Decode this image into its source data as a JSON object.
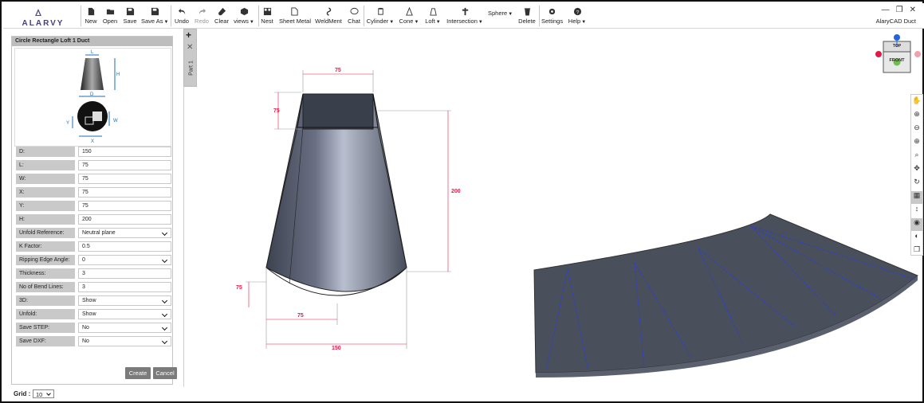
{
  "app": {
    "title": "AlaryCAD Duct",
    "logo_text": "ALARVY"
  },
  "toolbar": {
    "new": "New",
    "open": "Open",
    "save": "Save",
    "save_as": "Save As",
    "undo": "Undo",
    "redo": "Redo",
    "clear": "Clear",
    "views": "views",
    "nest": "Nest",
    "sheet_metal": "Sheet Metal",
    "weldment": "WeldMent",
    "chat": "Chat",
    "cylinder": "Cylinder",
    "cone": "Cone",
    "loft": "Loft",
    "intersection": "Intersection",
    "sphere": "Sphere",
    "delete": "Delete",
    "settings": "Settings",
    "help": "Help"
  },
  "panel": {
    "title": "Circle Rectangle Loft 1 Duct",
    "diagram_labels": {
      "L": "L",
      "H": "H",
      "D": "D",
      "Y": "Y",
      "W": "W",
      "X": "X"
    },
    "fields": [
      {
        "label": "D:",
        "value": "150",
        "type": "text"
      },
      {
        "label": "L:",
        "value": "75",
        "type": "text"
      },
      {
        "label": "W:",
        "value": "75",
        "type": "text"
      },
      {
        "label": "X:",
        "value": "75",
        "type": "text"
      },
      {
        "label": "Y:",
        "value": "75",
        "type": "text"
      },
      {
        "label": "H:",
        "value": "200",
        "type": "text"
      },
      {
        "label": "Unfold Reference:",
        "value": "Neutral plane",
        "type": "select"
      },
      {
        "label": "K Factor:",
        "value": "0.5",
        "type": "text"
      },
      {
        "label": "Ripping Edge Angle:",
        "value": "0",
        "type": "select"
      },
      {
        "label": "Thickness:",
        "value": "3",
        "type": "text"
      },
      {
        "label": "No of Bend Lines:",
        "value": "3",
        "type": "text"
      },
      {
        "label": "3D:",
        "value": "Show",
        "type": "select"
      },
      {
        "label": "Unfold:",
        "value": "Show",
        "type": "select"
      },
      {
        "label": "Save STEP:",
        "value": "No",
        "type": "select"
      },
      {
        "label": "Save DXF:",
        "value": "No",
        "type": "select"
      }
    ],
    "create": "Create",
    "cancel": "Cancel"
  },
  "tabs": {
    "part": "Part 1"
  },
  "grid": {
    "label": "Grid :",
    "value": "10"
  },
  "view_cube": {
    "top": "TOP",
    "front": "FRONT"
  },
  "model_dims": {
    "top_width": "75",
    "top_height": "75",
    "height": "200",
    "bottom_offset": "75",
    "bottom_x": "75",
    "bottom_width": "150"
  },
  "colors": {
    "accent_dim": "#e11b48",
    "model": "#4a4f5c",
    "bend_line": "#2b3fd6"
  }
}
